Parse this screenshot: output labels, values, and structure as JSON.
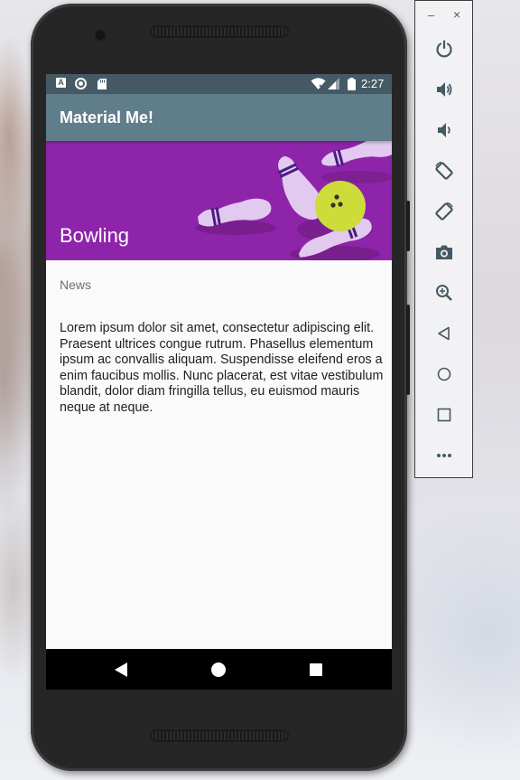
{
  "status_bar": {
    "time": "2:27",
    "left_icons": [
      "accessibility-a-icon",
      "circle-notification-icon",
      "sd-card-icon"
    ],
    "right_icons": [
      "wifi-icon",
      "signal-icon",
      "battery-icon"
    ],
    "app_label_glyph": "A"
  },
  "app_bar": {
    "title": "Material Me!",
    "color": "#607d8b",
    "status_color": "#455a64"
  },
  "card": {
    "title": "Bowling",
    "banner_color": "#8e24aa",
    "subtitle": "News",
    "body": "Lorem ipsum dolor sit amet, consectetur adipiscing elit. Praesent ultrices congue rutrum. Phasellus elementum ipsum ac convallis aliquam. Suspendisse eleifend eros a enim faucibus mollis. Nunc placerat, est vitae vestibulum blandit, dolor diam fringilla tellus, eu euismod mauris neque at neque."
  },
  "nav_bar": {
    "buttons": [
      "back-icon",
      "home-icon",
      "recents-icon"
    ]
  },
  "emulator_toolbar": {
    "window_controls": [
      "minimize",
      "close"
    ],
    "minimize_glyph": "–",
    "close_glyph": "×",
    "buttons": [
      "power",
      "volume-up",
      "volume-down",
      "rotate-left",
      "rotate-right",
      "screenshot",
      "zoom",
      "back",
      "home",
      "overview",
      "more"
    ]
  }
}
